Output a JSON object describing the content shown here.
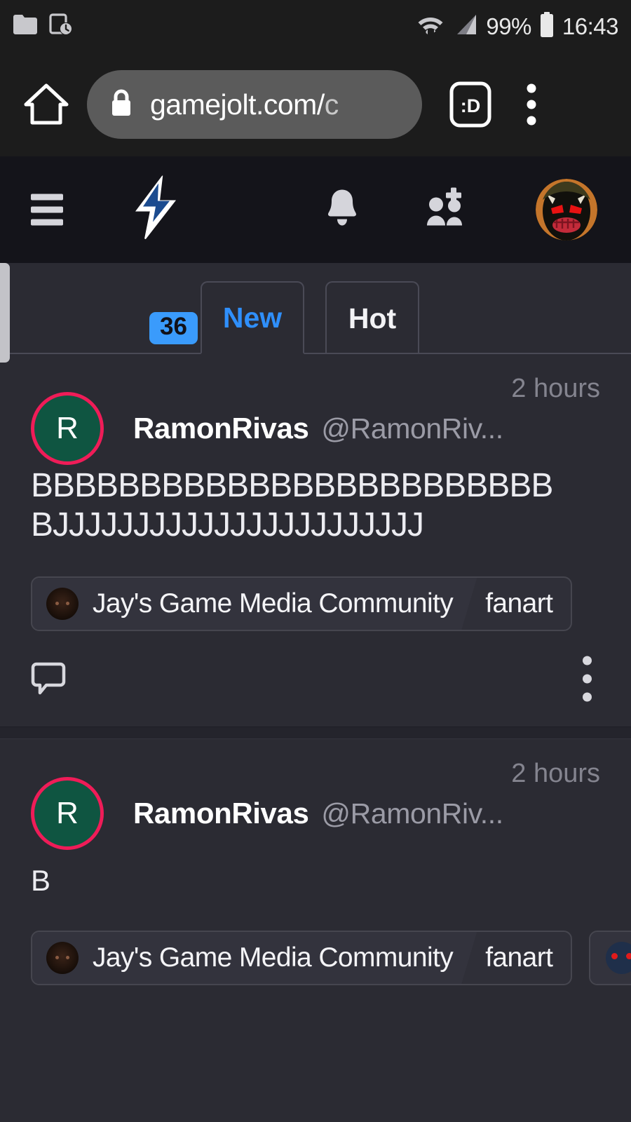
{
  "statusbar": {
    "icons_left": [
      "folder-icon",
      "device-clock-icon"
    ],
    "wifi_icon": "wifi-icon",
    "signal_icon": "cell-signal-icon",
    "battery_percent": "99%",
    "battery_icon": "battery-icon",
    "time": "16:43"
  },
  "browser": {
    "home_icon": "home-icon",
    "lock_icon": "lock-icon",
    "url_visible": "gamejolt.com/",
    "url_truncated": "c",
    "tabs_label": ":D",
    "menu_icon": "overflow-menu-icon"
  },
  "appnav": {
    "menu_icon": "hamburger-menu-icon",
    "bolt_icon": "lightning-bolt-icon",
    "bolt_badge_count": "36",
    "bell_icon": "notification-bell-icon",
    "friends_icon": "friend-requests-icon",
    "avatar_icon": "user-avatar"
  },
  "tabs": [
    {
      "label": "New",
      "active": true
    },
    {
      "label": "Hot",
      "active": false
    }
  ],
  "colors": {
    "accent_blue": "#2f8ffb",
    "badge_blue": "#3a9bfc",
    "avatar_ring_pink": "#ef1c58",
    "avatar_fill_green": "#0f5541",
    "page_bg": "#2b2b33",
    "nav_bg": "#14141a",
    "chrome_bg": "#1c1c1c"
  },
  "posts": [
    {
      "avatar_letter": "R",
      "display_name": "RamonRivas",
      "handle": "@RamonRiv...",
      "timestamp": "2 hours",
      "body_line1": "BBBBBBBBBBBBBBBBBBBBBBBB",
      "body_line2": "BJJJJJJJJJJJJJJJJJJJJJJJ",
      "chips": [
        {
          "avatar": "community-avatar",
          "name": "Jay's Game Media Community",
          "tag": "fanart"
        }
      ],
      "comment_icon": "comment-bubble-icon",
      "more_icon": "post-more-options-icon"
    },
    {
      "avatar_letter": "R",
      "display_name": "RamonRivas",
      "handle": "@RamonRiv...",
      "timestamp": "2 hours",
      "body_line1": "B",
      "chips": [
        {
          "avatar": "community-avatar",
          "name": "Jay's Game Media Community",
          "tag": "fanart"
        },
        {
          "avatar": "community-avatar-pixel",
          "name": "",
          "tag": ""
        }
      ]
    }
  ]
}
